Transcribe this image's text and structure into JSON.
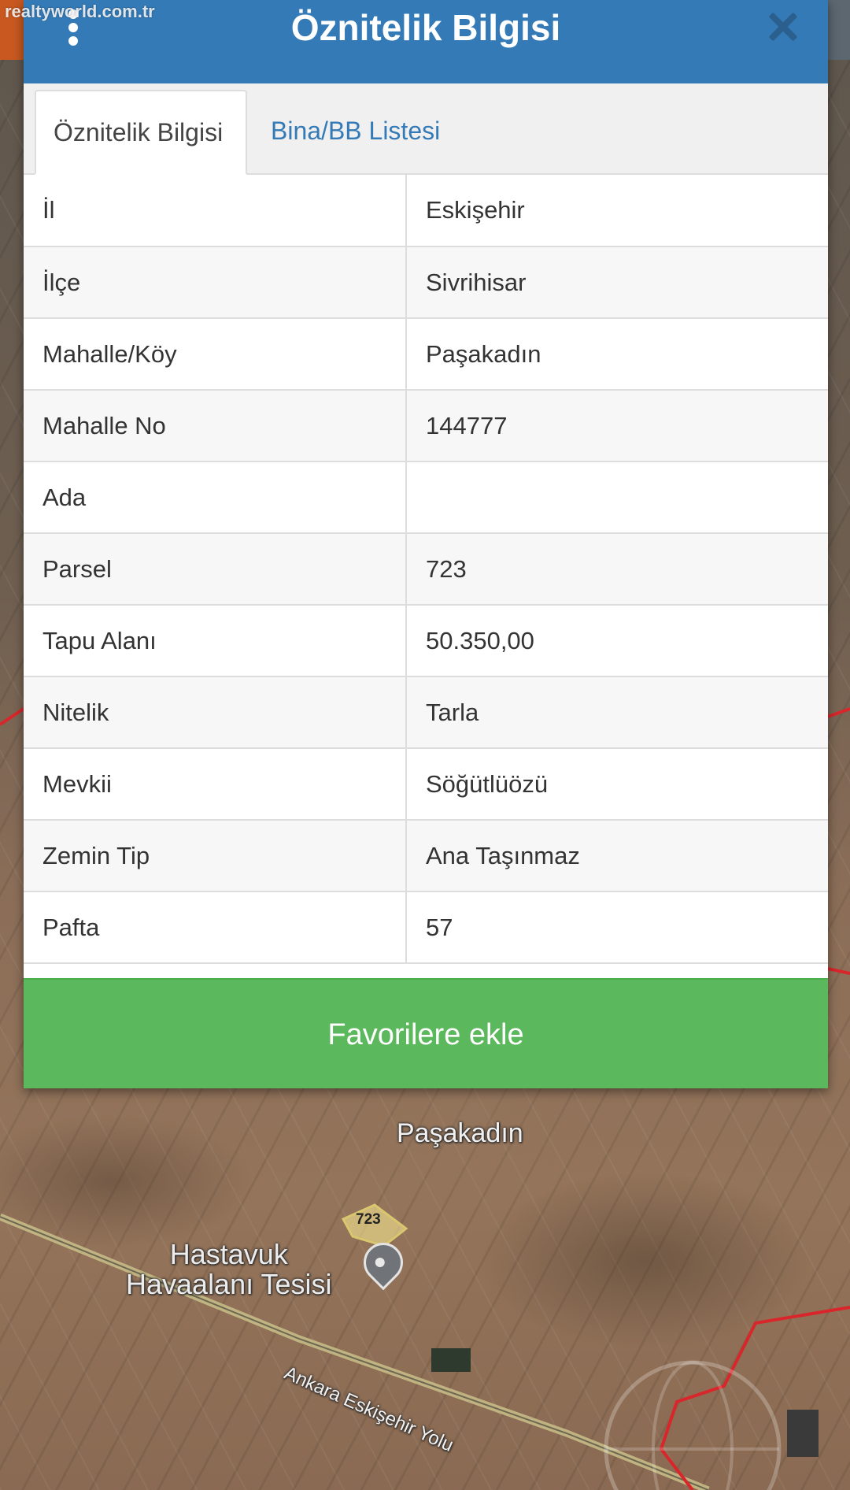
{
  "watermark": "realtyworld.com.tr",
  "dialog": {
    "title": "Öznitelik Bilgisi",
    "menu_icon": "vertical-dots-icon",
    "close_icon": "close-icon",
    "tabs": [
      {
        "label": "Öznitelik Bilgisi",
        "active": true
      },
      {
        "label": "Bina/BB Listesi",
        "active": false
      }
    ],
    "rows": [
      {
        "key": "İl",
        "value": "Eskişehir"
      },
      {
        "key": "İlçe",
        "value": "Sivrihisar"
      },
      {
        "key": "Mahalle/Köy",
        "value": "Paşakadın"
      },
      {
        "key": "Mahalle No",
        "value": "144777"
      },
      {
        "key": "Ada",
        "value": ""
      },
      {
        "key": "Parsel",
        "value": "723"
      },
      {
        "key": "Tapu Alanı",
        "value": "50.350,00"
      },
      {
        "key": "Nitelik",
        "value": "Tarla"
      },
      {
        "key": "Mevkii",
        "value": "Söğütlüözü"
      },
      {
        "key": "Zemin Tip",
        "value": "Ana Taşınmaz"
      },
      {
        "key": "Pafta",
        "value": "57"
      }
    ],
    "favorite_button": "Favorilere ekle"
  },
  "map": {
    "village_label": "Paşakadın",
    "facility_label_line1": "Hastavuk",
    "facility_label_line2": "Havaalanı Tesisi",
    "road_label": "Ankara Eskişehir Yolu",
    "parcel_label": "723"
  },
  "colors": {
    "header": "#337ab7",
    "button": "#5cb85c",
    "boundary": "#d8262a"
  }
}
